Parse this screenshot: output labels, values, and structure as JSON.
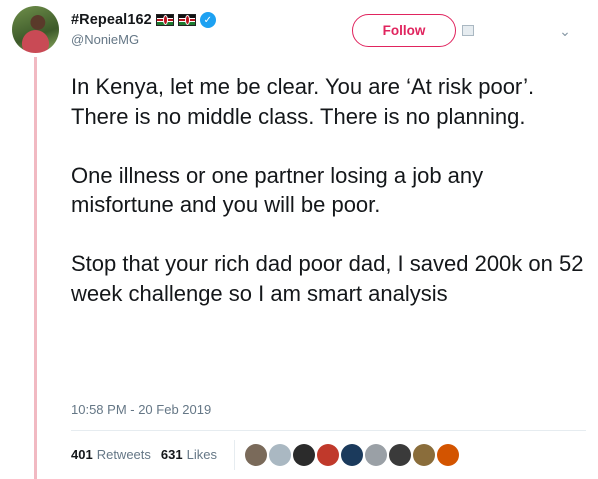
{
  "user": {
    "display_name": "#Repeal162",
    "handle": "@NonieMG",
    "flags": [
      "kenya-flag",
      "kenya-flag"
    ],
    "verified": true,
    "avatar": "profile-photo"
  },
  "actions": {
    "follow_label": "Follow",
    "more_icon": "chevron-down-icon"
  },
  "tweet": {
    "paragraphs": [
      "In Kenya, let me be clear. You are ‘At risk poor’. There is no middle class. There is no planning.",
      "One illness or one partner losing a job any misfortune and you will be poor.",
      "Stop that your rich dad poor dad, I saved 200k on 52 week challenge so I am smart analysis"
    ],
    "timestamp": "10:58 PM - 20 Feb 2019"
  },
  "stats": {
    "retweets_count": "401",
    "retweets_label": "Retweets",
    "likes_count": "631",
    "likes_label": "Likes"
  },
  "likers": [
    {
      "color": "#7a6a5a"
    },
    {
      "color": "#aab8c2"
    },
    {
      "color": "#2b2b2b"
    },
    {
      "color": "#c0392b"
    },
    {
      "color": "#1b3a5c"
    },
    {
      "color": "#9aa0a6"
    },
    {
      "color": "#3a3a3a"
    },
    {
      "color": "#8a6d3b"
    },
    {
      "color": "#d35400"
    }
  ],
  "colors": {
    "accent_follow": "#e0245e",
    "verified_blue": "#1da1f2",
    "muted_text": "#657786",
    "thread_line": "#f1b9c2"
  }
}
